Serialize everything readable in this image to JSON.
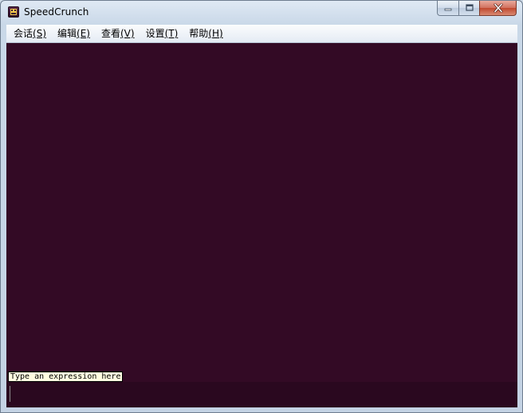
{
  "window": {
    "title": "SpeedCrunch",
    "app_icon": "speedcrunch-app-icon",
    "caption_buttons": [
      "minimize-icon",
      "maximize-icon",
      "close-icon"
    ]
  },
  "menu": {
    "items": [
      {
        "label": "会话",
        "mnemonic": "(S)"
      },
      {
        "label": "编辑",
        "mnemonic": "(E)"
      },
      {
        "label": "查看",
        "mnemonic": "(V)"
      },
      {
        "label": "设置",
        "mnemonic": "(T)"
      },
      {
        "label": "帮助",
        "mnemonic": "(H)"
      }
    ]
  },
  "display": {
    "background_color": "#330a25"
  },
  "editor": {
    "hint": "Type an expression here",
    "value": ""
  }
}
